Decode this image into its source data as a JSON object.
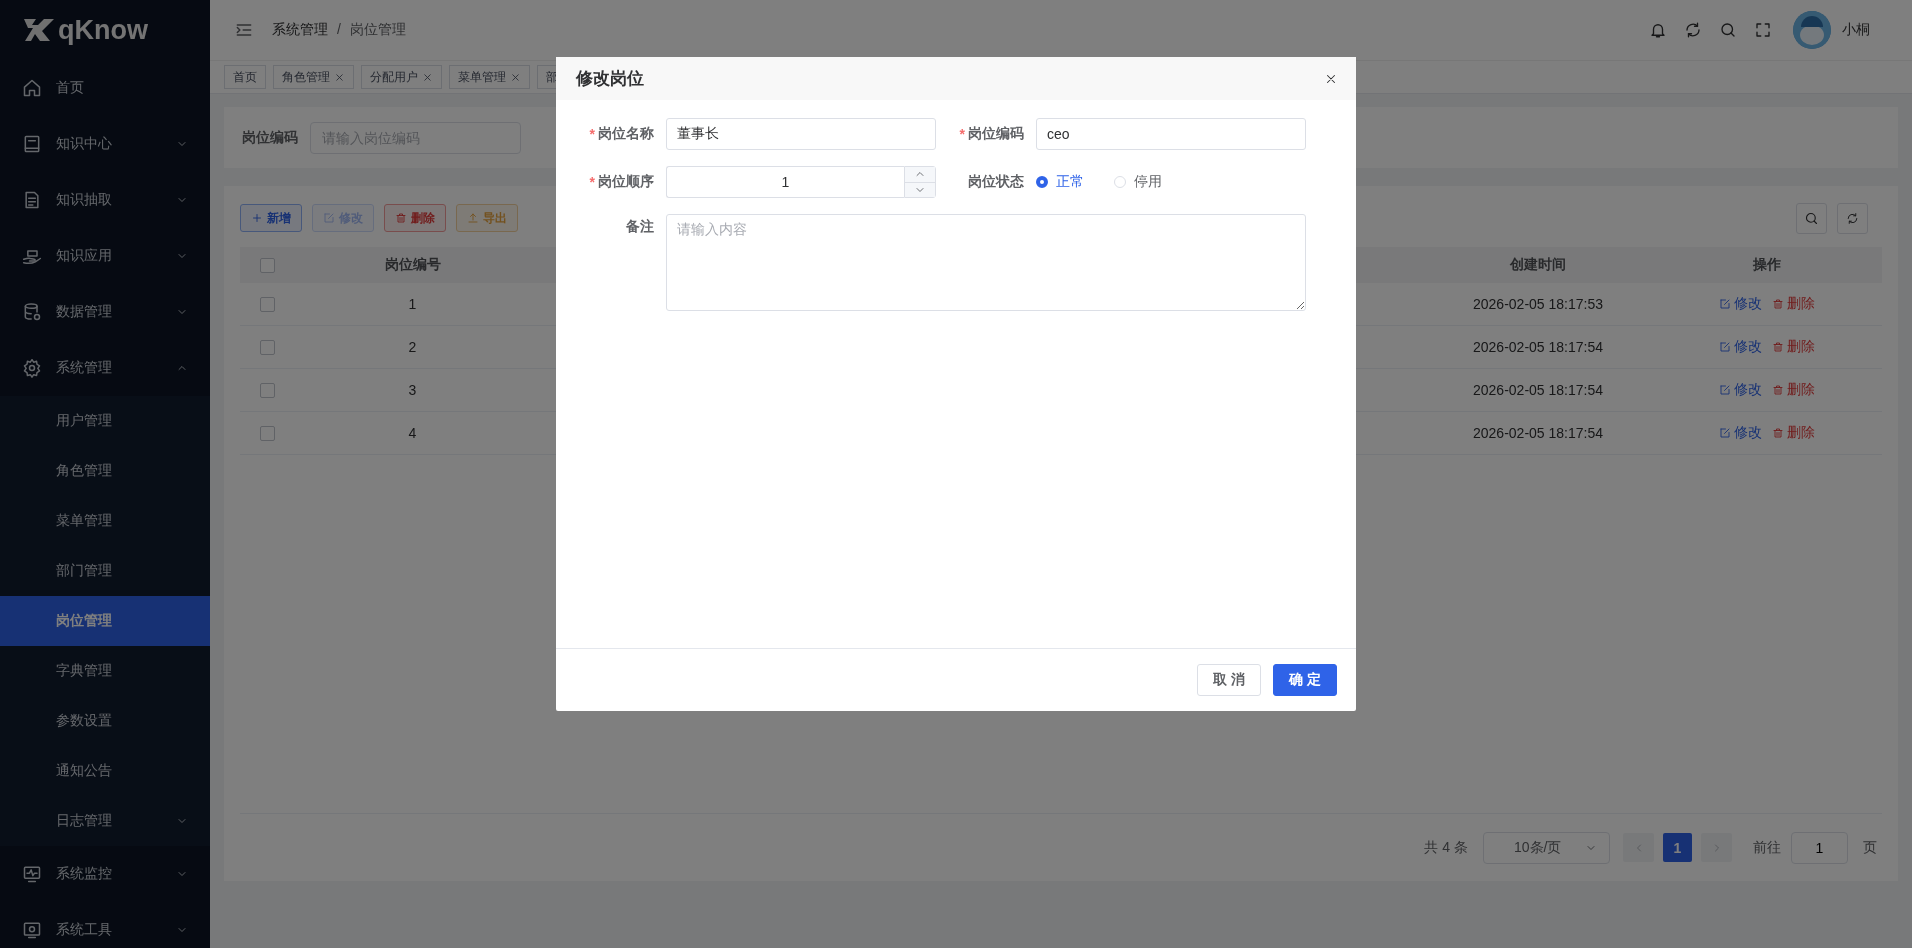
{
  "sidebar": {
    "logo": "qKnow",
    "items": [
      {
        "label": "首页",
        "kind": "link",
        "selected": false
      },
      {
        "label": "知识中心",
        "kind": "group",
        "expanded": false,
        "selected": false
      },
      {
        "label": "知识抽取",
        "kind": "group",
        "expanded": false,
        "selected": false
      },
      {
        "label": "知识应用",
        "kind": "group",
        "expanded": false,
        "selected": false
      },
      {
        "label": "数据管理",
        "kind": "group",
        "expanded": false,
        "selected": false
      },
      {
        "label": "系统管理",
        "kind": "group",
        "expanded": true,
        "selected": false,
        "children": [
          {
            "label": "用户管理",
            "kind": "link",
            "selected": false
          },
          {
            "label": "角色管理",
            "kind": "link",
            "selected": false
          },
          {
            "label": "菜单管理",
            "kind": "link",
            "selected": false
          },
          {
            "label": "部门管理",
            "kind": "link",
            "selected": false
          },
          {
            "label": "岗位管理",
            "kind": "link",
            "selected": true
          },
          {
            "label": "字典管理",
            "kind": "link",
            "selected": false
          },
          {
            "label": "参数设置",
            "kind": "link",
            "selected": false
          },
          {
            "label": "通知公告",
            "kind": "link",
            "selected": false
          },
          {
            "label": "日志管理",
            "kind": "group",
            "expanded": false,
            "selected": false
          }
        ]
      },
      {
        "label": "系统监控",
        "kind": "group",
        "expanded": false,
        "selected": false
      },
      {
        "label": "系统工具",
        "kind": "group",
        "expanded": false,
        "selected": false
      }
    ]
  },
  "header": {
    "breadcrumb": [
      "系统管理",
      "岗位管理"
    ],
    "separator": "/",
    "user_name": "小桐"
  },
  "tags": [
    {
      "label": "首页",
      "closable": false
    },
    {
      "label": "角色管理",
      "closable": true
    },
    {
      "label": "分配用户",
      "closable": true
    },
    {
      "label": "菜单管理",
      "closable": true
    },
    {
      "label": "部",
      "closable": false
    }
  ],
  "search_form": {
    "fields": [
      {
        "label": "岗位编码",
        "placeholder": "请输入岗位编码"
      }
    ]
  },
  "toolbar": {
    "buttons": [
      {
        "label": "新增",
        "kind": "add",
        "disabled": false
      },
      {
        "label": "修改",
        "kind": "edit",
        "disabled": true
      },
      {
        "label": "删除",
        "kind": "delete",
        "disabled": false
      },
      {
        "label": "导出",
        "kind": "export",
        "disabled": false
      }
    ]
  },
  "table": {
    "columns": [
      "岗位编号",
      "创建时间",
      "操作"
    ],
    "all_checked": false,
    "rows": [
      {
        "checked": false,
        "cells": [
          "1",
          "2026-02-05 18:17:53"
        ],
        "actions": [
          {
            "label": "修改",
            "kind": "edit"
          },
          {
            "label": "删除",
            "kind": "delete"
          }
        ]
      },
      {
        "checked": false,
        "cells": [
          "2",
          "2026-02-05 18:17:54"
        ],
        "actions": [
          {
            "label": "修改",
            "kind": "edit"
          },
          {
            "label": "删除",
            "kind": "delete"
          }
        ]
      },
      {
        "checked": false,
        "cells": [
          "3",
          "2026-02-05 18:17:54"
        ],
        "actions": [
          {
            "label": "修改",
            "kind": "edit"
          },
          {
            "label": "删除",
            "kind": "delete"
          }
        ]
      },
      {
        "checked": false,
        "cells": [
          "4",
          "2026-02-05 18:17:54"
        ],
        "actions": [
          {
            "label": "修改",
            "kind": "edit"
          },
          {
            "label": "删除",
            "kind": "delete"
          }
        ]
      }
    ]
  },
  "pagination": {
    "total": "共 4 条",
    "page_size": "10条/页",
    "pages": [
      {
        "label": "1",
        "selected": true
      }
    ],
    "goto_label": "前往",
    "goto_value": "1",
    "page_suffix": "页"
  },
  "dialog": {
    "title": "修改岗位",
    "required_mark": "*",
    "fields": [
      {
        "kind": "text",
        "label": "岗位名称",
        "required": true,
        "value": "董事长"
      },
      {
        "kind": "text",
        "label": "岗位编码",
        "required": true,
        "value": "ceo"
      },
      {
        "kind": "number",
        "label": "岗位顺序",
        "required": true,
        "value": "1"
      },
      {
        "kind": "radio",
        "label": "岗位状态",
        "required": false,
        "options": [
          {
            "label": "正常",
            "selected": true
          },
          {
            "label": "停用",
            "selected": false
          }
        ]
      },
      {
        "kind": "textarea",
        "label": "备注",
        "required": false,
        "placeholder": "请输入内容"
      }
    ],
    "buttons": [
      {
        "label": "取 消",
        "kind": "default"
      },
      {
        "label": "确 定",
        "kind": "primary"
      }
    ]
  }
}
